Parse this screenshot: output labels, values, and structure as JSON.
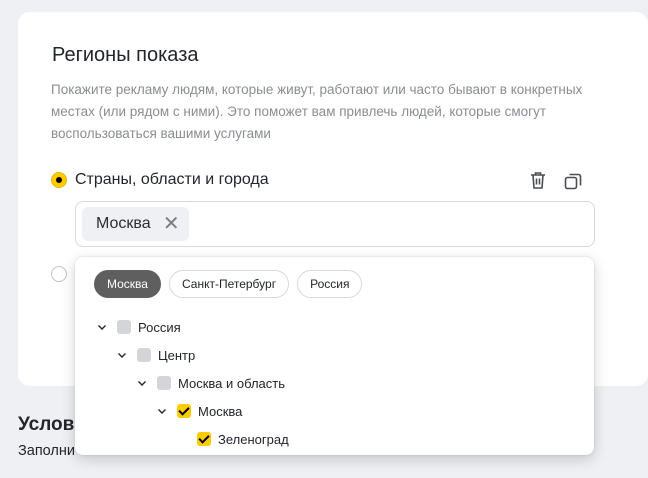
{
  "form": {
    "title": "Регионы показа",
    "description": "Покажите рекламу людям, которые живут, работают или часто бывают в конкретных местах (или рядом с ними). Это поможет вам привлечь людей, которые смогут воспользоваться вашими услугами",
    "radio_label": "Страны, области и города",
    "selected_chip": "Москва",
    "chip_remove": "✕"
  },
  "dropdown": {
    "pills": [
      "Москва",
      "Санкт-Петербург",
      "Россия"
    ],
    "tree": [
      {
        "label": "Россия",
        "checked": false
      },
      {
        "label": "Центр",
        "checked": false
      },
      {
        "label": "Москва и область",
        "checked": false
      },
      {
        "label": "Москва",
        "checked": true
      },
      {
        "label": "Зеленоград",
        "checked": true
      }
    ]
  },
  "section2": {
    "title": "Услови",
    "description": "Заполни"
  },
  "icons": {
    "delete": "trash-icon",
    "copy": "copy-icon"
  },
  "colors": {
    "accent": "#ffcc00",
    "active_pill": "#5f5f5f"
  }
}
